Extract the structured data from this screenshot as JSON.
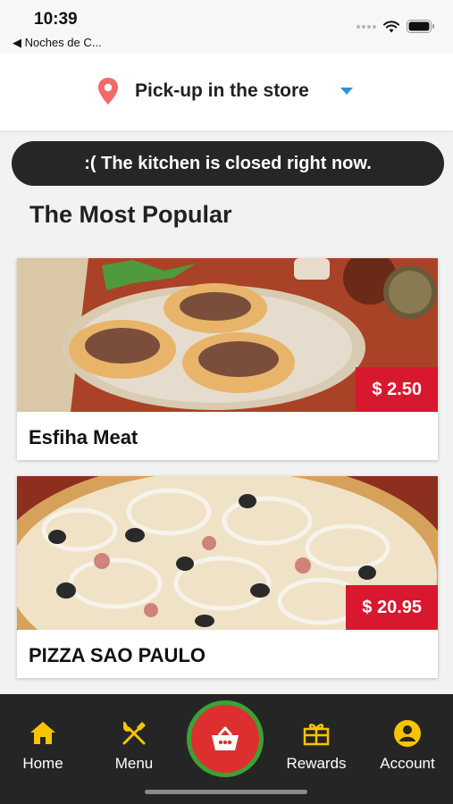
{
  "status_bar": {
    "time": "10:39",
    "back_label": "◀ Noches de C..."
  },
  "header": {
    "pickup_label": "Pick-up in the store"
  },
  "banner": {
    "text": ":( The kitchen is closed right now."
  },
  "section": {
    "title": "The Most Popular"
  },
  "products": [
    {
      "name": "Esfiha Meat",
      "price": "$ 2.50"
    },
    {
      "name": "PIZZA SAO PAULO",
      "price": "$ 20.95"
    }
  ],
  "tabs": {
    "home": "Home",
    "menu": "Menu",
    "rewards": "Rewards",
    "account": "Account"
  },
  "colors": {
    "accent_yellow": "#f7c500",
    "price_red": "#d8182e",
    "cart_red": "#dd2f2f",
    "cart_ring_green": "#3aa235",
    "pin_red": "#f26a6a",
    "dropdown_blue": "#2e93d6"
  },
  "icons": [
    "wifi-icon",
    "battery-icon",
    "location-pin-icon",
    "chevron-down-icon",
    "home-icon",
    "fork-knife-icon",
    "basket-icon",
    "gift-icon",
    "account-icon"
  ]
}
